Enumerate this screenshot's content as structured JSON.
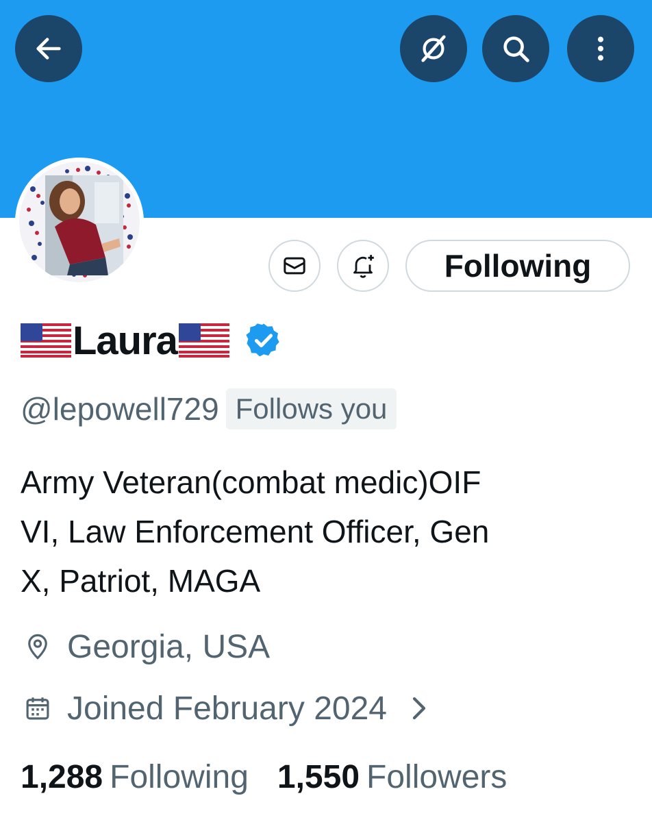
{
  "header": {
    "back_icon": "arrow-left-icon",
    "grok_icon": "grok-icon",
    "search_icon": "search-icon",
    "more_icon": "more-vertical-icon"
  },
  "profile": {
    "name": "Laura",
    "name_emoji": "flag-united-states",
    "verified": true,
    "handle": "@lepowell729",
    "follows_you": "Follows you",
    "bio_lines": [
      "Army Veteran(combat medic)OIF",
      "VI, Law Enforcement Officer, Gen",
      "X, Patriot, MAGA"
    ],
    "location": "Georgia, USA",
    "joined": "Joined February 2024",
    "following_count": "1,288",
    "following_label": "Following",
    "followers_count": "1,550",
    "followers_label": "Followers"
  },
  "actions": {
    "message_icon": "envelope-icon",
    "notify_icon": "bell-plus-icon",
    "following_button": "Following"
  },
  "colors": {
    "banner": "#1d9bf0",
    "header_button": "#1b466a",
    "verified": "#1d9bf0",
    "secondary_text": "#536471",
    "primary_text": "#0f1419"
  }
}
